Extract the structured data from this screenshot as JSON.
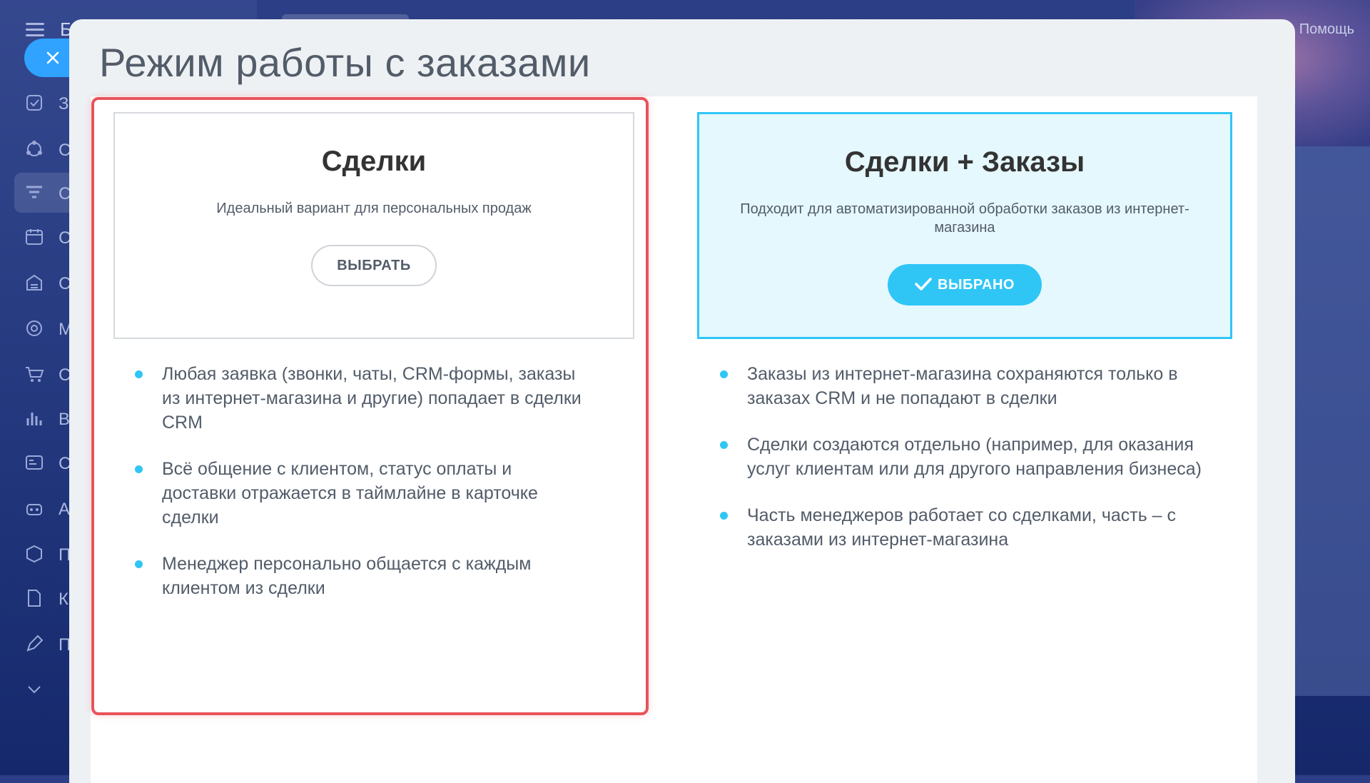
{
  "background": {
    "brand_letter": "Б",
    "sidebar_letters": [
      "З",
      "С",
      "С",
      "С",
      "С",
      "М",
      "С",
      "В",
      "С",
      "А",
      "П",
      "К",
      "П"
    ],
    "help_label": "Помощь"
  },
  "slider": {
    "close_icon": "close-icon",
    "title": "Режим работы с заказами"
  },
  "options": [
    {
      "title": "Сделки",
      "description": "Идеальный вариант для персональных продаж",
      "button_label": "ВЫБРАТЬ",
      "selected": false,
      "features": [
        "Любая заявка (звонки, чаты, CRM-формы, заказы из интернет-магазина и другие) попадает в сделки CRM",
        "Всё общение с клиентом, статус оплаты и доставки отражается в таймлайне в карточке сделки",
        "Менеджер персонально общается с каждым клиентом из сделки"
      ]
    },
    {
      "title": "Сделки + Заказы",
      "description": "Подходит для автоматизированной обработки заказов из интернет-магазина",
      "button_label": "ВЫБРАНО",
      "selected": true,
      "features": [
        "Заказы из интернет-магазина сохраняются только в заказах CRM и не попадают в сделки",
        "Сделки создаются отдельно (например, для оказания услуг клиентам или для другого направления бизнеса)",
        "Часть менеджеров работает со сделками, часть – с заказами из интернет-магазина"
      ]
    }
  ],
  "colors": {
    "accent": "#2fc6f6",
    "highlight": "#e8535a",
    "close_button": "#2fa3ff"
  }
}
